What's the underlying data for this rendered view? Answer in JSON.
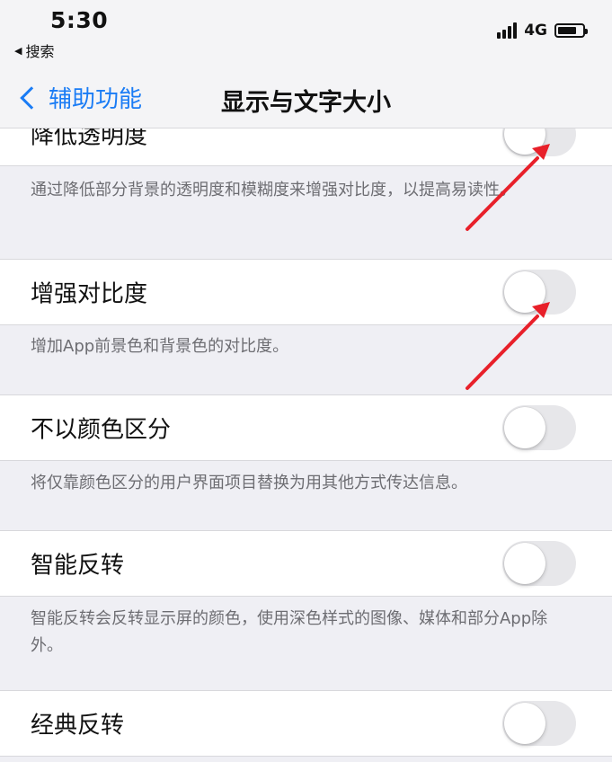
{
  "status_bar": {
    "time": "5:30",
    "back_app": "搜索",
    "network": "4G",
    "battery_level": 0.75
  },
  "nav": {
    "back_label": "辅助功能",
    "title": "显示与文字大小"
  },
  "settings": [
    {
      "label": "降低透明度",
      "on": false,
      "footer": "通过降低部分背景的透明度和模糊度来增强对比度，以提高易读性。"
    },
    {
      "label": "增强对比度",
      "on": false,
      "footer": "增加App前景色和背景色的对比度。"
    },
    {
      "label": "不以颜色区分",
      "on": false,
      "footer": "将仅靠颜色区分的用户界面项目替换为用其他方式传达信息。"
    },
    {
      "label": "智能反转",
      "on": false,
      "footer": "智能反转会反转显示屏的颜色，使用深色样式的图像、媒体和部分App除外。"
    },
    {
      "label": "经典反转",
      "on": false
    }
  ],
  "colors": {
    "accent": "#1a7cf5",
    "annotation_arrow": "#e8202a",
    "toggle_off": "#e7e7ea"
  }
}
